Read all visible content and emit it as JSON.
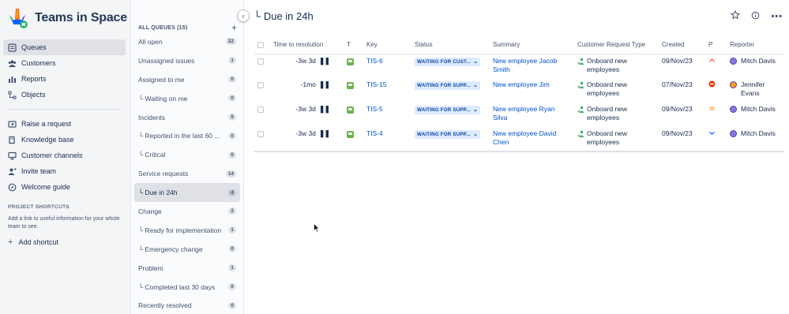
{
  "sidebar": {
    "brand_title": "Teams in Space",
    "nav_primary": [
      {
        "label": "Queues",
        "icon": "queues-icon",
        "active": true
      },
      {
        "label": "Customers",
        "icon": "customers-icon"
      },
      {
        "label": "Reports",
        "icon": "reports-icon"
      },
      {
        "label": "Objects",
        "icon": "objects-icon"
      }
    ],
    "nav_secondary": [
      {
        "label": "Raise a request",
        "icon": "raise-request-icon"
      },
      {
        "label": "Knowledge base",
        "icon": "knowledge-base-icon"
      },
      {
        "label": "Customer channels",
        "icon": "customer-channels-icon"
      },
      {
        "label": "Invite team",
        "icon": "invite-team-icon"
      },
      {
        "label": "Welcome guide",
        "icon": "welcome-guide-icon"
      }
    ],
    "shortcuts_title": "PROJECT SHORTCUTS",
    "shortcuts_desc": "Add a link to useful information for your whole team to see.",
    "add_shortcut": "Add shortcut"
  },
  "queues": {
    "header": "ALL QUEUES (15)",
    "items": [
      {
        "label": "All open",
        "count": "22"
      },
      {
        "label": "Unassigned issues",
        "count": "1"
      },
      {
        "label": "Assigned to me",
        "count": "0"
      },
      {
        "label": "└ Waiting on me",
        "count": "0"
      },
      {
        "label": "Incidents",
        "count": "5"
      },
      {
        "label": "└ Reported in the last 60 ...",
        "count": "0"
      },
      {
        "label": "└ Critical",
        "count": "0"
      },
      {
        "label": "Service requests",
        "count": "14"
      },
      {
        "label": "└ Due in 24h",
        "count": "4",
        "active": true
      },
      {
        "label": "Change",
        "count": "2"
      },
      {
        "label": "└ Ready for implementation",
        "count": "1"
      },
      {
        "label": "└ Emergency change",
        "count": "0"
      },
      {
        "label": "Problem",
        "count": "1"
      },
      {
        "label": "└ Completed last 30 days",
        "count": "0"
      },
      {
        "label": "Recently resolved",
        "count": "0"
      }
    ]
  },
  "main": {
    "title": "└ Due in 24h",
    "columns": [
      "Time to resolution",
      "T",
      "Key",
      "Status",
      "Summary",
      "Customer Request Type",
      "Created",
      "P",
      "Reporter"
    ],
    "rows": [
      {
        "ttr": "-3w 3d",
        "key": "TIS-6",
        "status": "WAITING FOR CUST...",
        "summary": "New employee Jacob Smith",
        "crt": "Onboard new employees",
        "created": "09/Nov/23",
        "priority": "high",
        "reporter": "Mitch Davis",
        "avatar_color": "#8777d9"
      },
      {
        "ttr": "-1mo",
        "key": "TIS-15",
        "status": "WAITING FOR SUPP...",
        "summary": "New employee Jim",
        "crt": "Onboard new employees",
        "created": "07/Nov/23",
        "priority": "blocker",
        "reporter": "Jennifer Evans",
        "avatar_color": "#ff991f"
      },
      {
        "ttr": "-3w 3d",
        "key": "TIS-5",
        "status": "WAITING FOR SUPP...",
        "summary": "New employee Ryan Silva",
        "crt": "Onboard new employees",
        "created": "09/Nov/23",
        "priority": "medium",
        "reporter": "Mitch Davis",
        "avatar_color": "#8777d9"
      },
      {
        "ttr": "-3w 3d",
        "key": "TIS-4",
        "status": "WAITING FOR SUPP...",
        "summary": "New employee David Chen",
        "crt": "Onboard new employees",
        "created": "09/Nov/23",
        "priority": "low",
        "reporter": "Mitch Davis",
        "avatar_color": "#8777d9"
      }
    ]
  },
  "colors": {
    "link": "#0052cc",
    "status_bg": "#deebff",
    "status_fg": "#0747a6",
    "request_type_icon": "#6bb34d"
  }
}
